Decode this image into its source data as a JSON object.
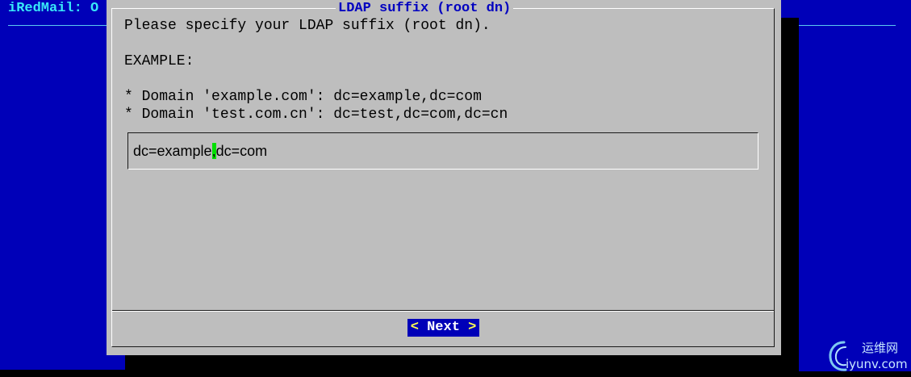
{
  "backtitle": "iRedMail: O",
  "dialog": {
    "title": "LDAP suffix (root dn)",
    "lines": [
      "Please specify your LDAP suffix (root dn).",
      "EXAMPLE:",
      "* Domain 'example.com': dc=example,dc=com",
      "* Domain 'test.com.cn': dc=test,dc=com,dc=cn"
    ],
    "input": {
      "before_cursor": "dc=example",
      "cursor_char": ",",
      "after_cursor": "dc=com"
    },
    "next_button": {
      "open": "< ",
      "label": "Next",
      "close": " >"
    }
  },
  "watermark": {
    "cn": "运维网",
    "en": "iyunv.com"
  },
  "colors": {
    "background": "#0000b8",
    "dialog": "#bebebe",
    "title": "#0000c0",
    "backtitle": "#38e8f8",
    "cursor": "#00e000",
    "button_bg": "#0000b8",
    "button_fg": "#ffff50"
  }
}
